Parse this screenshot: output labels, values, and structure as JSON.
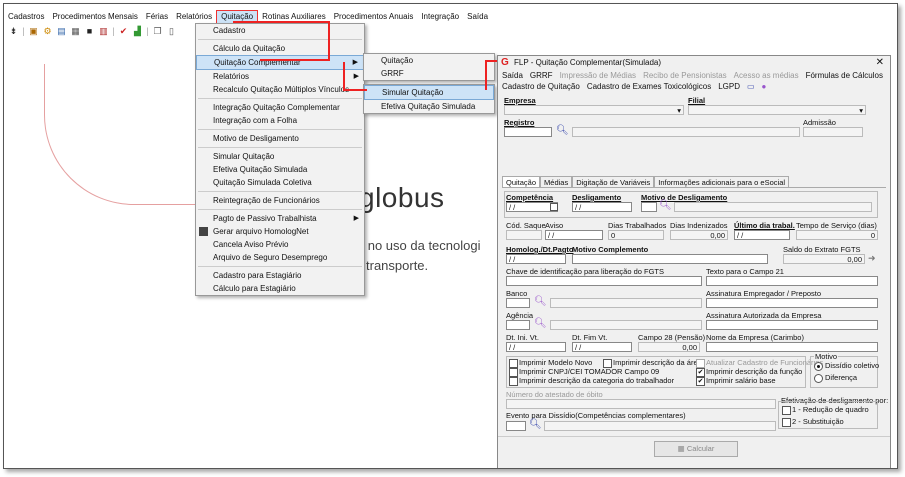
{
  "menubar": [
    "Cadastros",
    "Procedimentos Mensais",
    "Férias",
    "Relatórios",
    "Quitação",
    "Rotinas Auxiliares",
    "Procedimentos Anuais",
    "Integração",
    "Saída"
  ],
  "background": {
    "logo": "globus",
    "text1": "ia no uso da tecnologi",
    "text2": "transporte."
  },
  "quitacao_menu": {
    "items": [
      {
        "label": "Cadastro"
      },
      {
        "label": "Cálculo da Quitação"
      },
      {
        "label": "Quitação Complementar",
        "submenu": true,
        "highlight": true
      },
      {
        "label": "Relatórios",
        "submenu": true
      },
      {
        "label": "Recalculo Quitação Múltiplos Vínculos"
      },
      {
        "label": "Integração Quitação Complementar"
      },
      {
        "label": "Integração com a Folha"
      },
      {
        "label": "Motivo de Desligamento"
      },
      {
        "label": "Simular Quitação"
      },
      {
        "label": "Efetiva Quitação Simulada"
      },
      {
        "label": "Quitação Simulada Coletiva"
      },
      {
        "label": "Reintegração de Funcionários"
      },
      {
        "label": "Pagto de Passivo Trabalhista",
        "submenu": true
      },
      {
        "label": "Gerar arquivo HomologNet",
        "icon": true
      },
      {
        "label": "Cancela Aviso Prévio"
      },
      {
        "label": "Arquivo de Seguro Desemprego"
      },
      {
        "label": "Cadastro para Estagiário"
      },
      {
        "label": "Cálculo para Estagiário"
      }
    ]
  },
  "complementar_menu": {
    "items": [
      "Quitação",
      "GRRF"
    ]
  },
  "simular_menu": {
    "items": [
      "Simular Quitação",
      "Efetiva Quitação Simulada"
    ]
  },
  "dialog": {
    "title": "FLP - Quitação Complementar(Simulada)",
    "menu1": [
      "Saída",
      "GRRF",
      "Impressão de Médias",
      "Recibo de Pensionistas",
      "Acesso as médias",
      "Fórmulas de Cálculos"
    ],
    "menu2": [
      "Cadastro de Quitação",
      "Cadastro de Exames Toxicológicos",
      "LGPD"
    ],
    "empresa_label": "Empresa",
    "filial_label": "Filial",
    "registro_label": "Registro",
    "admissao_label": "Admissão",
    "tabs": [
      "Quitação",
      "Médias",
      "Digitação de Variáveis",
      "Informações adicionais para o eSocial"
    ],
    "competencia_label": "Competência",
    "competencia_value": "/ /",
    "desligamento_label": "Desligamento",
    "desligamento_value": "/ /",
    "motivo_label": "Motivo de Desligamento",
    "cod_saque_label": "Cód. Saque",
    "aviso_label": "Aviso",
    "aviso_value": "/ /",
    "dias_trab_label": "Dias Trabalhados",
    "dias_trab_value": "0",
    "dias_ind_label": "Dias Indenizados",
    "dias_ind_value": "0,00",
    "ultimo_dia_label": "Último dia trabal.",
    "ultimo_dia_value": "/ /",
    "tempo_servico_label": "Tempo de Serviço (dias)",
    "tempo_servico_value": "0",
    "homolog_label": "Homolog./Dt.Pagto",
    "homolog_value": "/ /",
    "motivo_compl_label": "Motivo Complemento",
    "saldo_label": "Saldo do Extrato FGTS",
    "saldo_value": "0,00",
    "chave_label": "Chave de identificação para liberação do FGTS",
    "texto21_label": "Texto para o Campo 21",
    "banco_label": "Banco",
    "assin_emp_label": "Assinatura Empregador / Preposto",
    "agencia_label": "Agência",
    "assin_aut_label": "Assinatura Autorizada da Empresa",
    "dt_ini_label": "Dt. Ini. Vt.",
    "dt_ini_value": "/ /",
    "dt_fim_label": "Dt. Fim Vt.",
    "dt_fim_value": "/ /",
    "campo28_label": "Campo 28 (Pensão)",
    "campo28_value": "0,00",
    "nome_empresa_label": "Nome da Empresa (Carimbo)",
    "checks": {
      "imprimir_modelo_novo": "Imprimir Modelo Novo",
      "imprimir_cnpj": "Imprimir CNPJ/CEI TOMADOR Campo 09",
      "imprimir_categoria": "Imprimir descrição da categoria do trabalhador",
      "imprimir_area": "Imprimir descrição da área",
      "atualizar_cadastro": "Atualizar Cadastro de Funcionários",
      "imprimir_funcao": "Imprimir descrição da função",
      "imprimir_salario": "Imprimir salário base"
    },
    "motivo_group_label": "Motivo",
    "motivo_options": [
      "Dissídio coletivo",
      "Diferença"
    ],
    "numero_atestado_label": "Número do atestado de óbito",
    "evento_label": "Evento para Dissídio(Competências complementares)",
    "efetivacao_label": "Efetivação de desligamento por:",
    "efetivacao_options": [
      "1 - Redução de quadro",
      "2 - Substituição"
    ],
    "calcular_label": "Calcular"
  }
}
